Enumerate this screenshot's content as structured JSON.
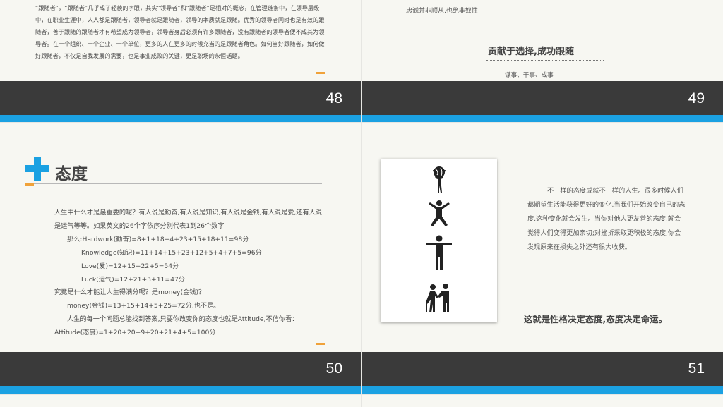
{
  "slides": {
    "s48": {
      "page_number": "48",
      "paragraph": "“跟随者”，“跟随者”几乎成了轻藐的字眼，其实“领导者”和“跟随者”是相对的概念，在管理链条中，在领导层级中，在职业生涯中，人人都是跟随者，领导者就是跟随者，领导的本质就是跟随。优秀的领导者同时也是有效的跟随者，善于跟随的跟随者才有希望成为领导者，领导者身后必须有许多跟随者，没有跟随者的领导者便不成其为领导者。在一个组织、一个企业、一个单位，更多的人在更多的时候充当的是跟随者角色。如何当好跟随者，如何做好跟随者，不仅是自我发展的需要，也是事业成败的关键，更是职场的永恒话题。"
    },
    "s49": {
      "page_number": "49",
      "quote": "忠诚并非顺从,也绝非奴性",
      "heading": "贡献于选择,成功跟随",
      "subtitle": "谋事、干事、成事"
    },
    "s50": {
      "page_number": "50",
      "title": "态度",
      "lines": [
        "人生中什么才是最重要的呢？有人说是勤奋,有人说是知识,有人说是金钱,有人说是爱,还有人说",
        "是运气等等。如果英文的26个字依序分别代表1到26个数字",
        "那么:Hardwork(勤奋)=8+1+18+4+23+15+18+11=98分",
        "Knowledge(知识)=11+14+15+23+12+5+4+7+5=96分",
        "Love(爱)=12+15+22+5=54分",
        "Luck(运气)=12+21+3+11=47分",
        "究竟是什么才能让人生得满分呢？是money(金钱)？",
        "money(金钱)=13+15+14+5+25=72分,也不是。",
        "人生的每一个问题总能找到答案,只要你改变你的态度也就是Attitude,不信你看：",
        "Attitude(态度)=1+20+20+9+20+21+4+5=100分"
      ]
    },
    "s51": {
      "page_number": "51",
      "paragraph": "不一样的态度成就不一样的人生。很多时候人们都期望生活能获得更好的变化,当我们开始改变自己的态度,这种变化就会发生。当你对他人更友善的态度,就会觉得人们变得更加亲切;对挫折采取更积极的态度,你会发现原来在损失之外还有很大收获。",
      "conclusion": "这就是性格决定态度,态度决定命运。",
      "icons": [
        "globe-carrier-icon",
        "jumping-person-icon",
        "standing-person-icon",
        "elderly-helper-icon"
      ]
    }
  },
  "colors": {
    "accent_blue": "#1ba1e2",
    "dark_bar": "#3a3a3a",
    "accent_orange": "#f0a23a"
  }
}
